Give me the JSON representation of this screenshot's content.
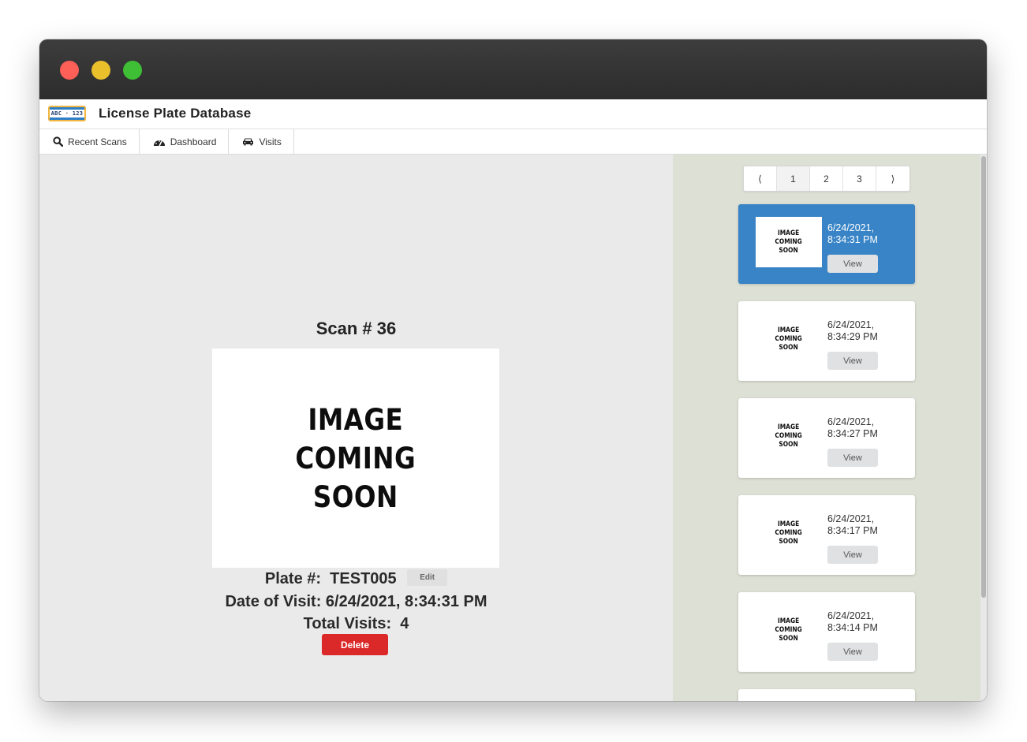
{
  "app": {
    "title": "License Plate Database",
    "logo_text": "ABC · 123"
  },
  "nav": {
    "tabs": [
      {
        "label": "Recent Scans",
        "icon": "search-icon"
      },
      {
        "label": "Dashboard",
        "icon": "dashboard-gauge-icon"
      },
      {
        "label": "Visits",
        "icon": "car-icon"
      }
    ]
  },
  "scan": {
    "title": "Scan # 36",
    "image_placeholder": [
      "IMAGE",
      "COMING",
      "SOON"
    ],
    "plate_label": "Plate #:",
    "plate_value": "TEST005",
    "edit_label": "Edit",
    "date_label": "Date of Visit:",
    "date_value": "6/24/2021, 8:34:31 PM",
    "visits_label": "Total Visits:",
    "visits_value": "4",
    "delete_label": "Delete"
  },
  "pagination": {
    "prev": "⟨",
    "pages": [
      "1",
      "2",
      "3"
    ],
    "next": "⟩",
    "active_page": "1"
  },
  "recent": {
    "view_label": "View",
    "thumb_text": [
      "IMAGE",
      "COMING",
      "SOON"
    ],
    "items": [
      {
        "date": "6/24/2021,",
        "time": "8:34:31 PM",
        "selected": true
      },
      {
        "date": "6/24/2021,",
        "time": "8:34:29 PM",
        "selected": false
      },
      {
        "date": "6/24/2021,",
        "time": "8:34:27 PM",
        "selected": false
      },
      {
        "date": "6/24/2021,",
        "time": "8:34:17 PM",
        "selected": false
      },
      {
        "date": "6/24/2021,",
        "time": "8:34:14 PM",
        "selected": false
      }
    ]
  },
  "colors": {
    "selected_card": "#3884c6",
    "delete": "#db2828",
    "sidebar_bg": "#dde0d5"
  }
}
